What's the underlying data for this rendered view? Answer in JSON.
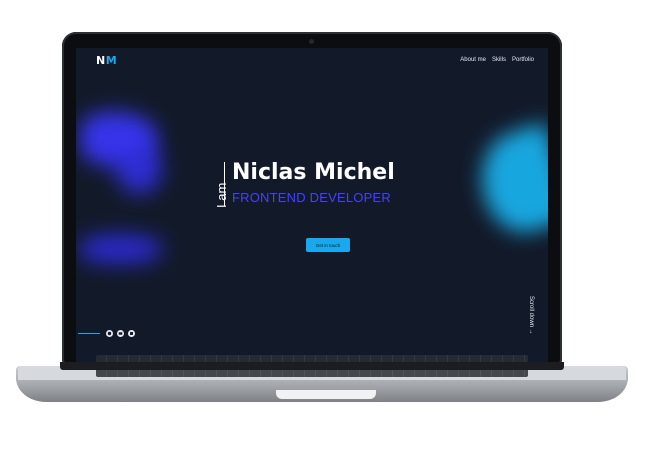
{
  "site": {
    "logo": {
      "first": "N",
      "second": "M"
    },
    "nav": [
      {
        "label": "About me"
      },
      {
        "label": "Skills"
      },
      {
        "label": "Portfolio"
      }
    ],
    "hero": {
      "prefix": "I am",
      "name": "Niclas Michel",
      "role": "FRONTEND DEVELOPER",
      "cta": "Get in touch"
    },
    "social_icons": [
      "github-icon",
      "email-icon",
      "linkedin-icon"
    ],
    "scroll_label": "Scroll down →"
  },
  "colors": {
    "background": "#121a2a",
    "accent_blue": "#19a8ec",
    "accent_purple": "#4540ff",
    "text": "#ffffff"
  }
}
